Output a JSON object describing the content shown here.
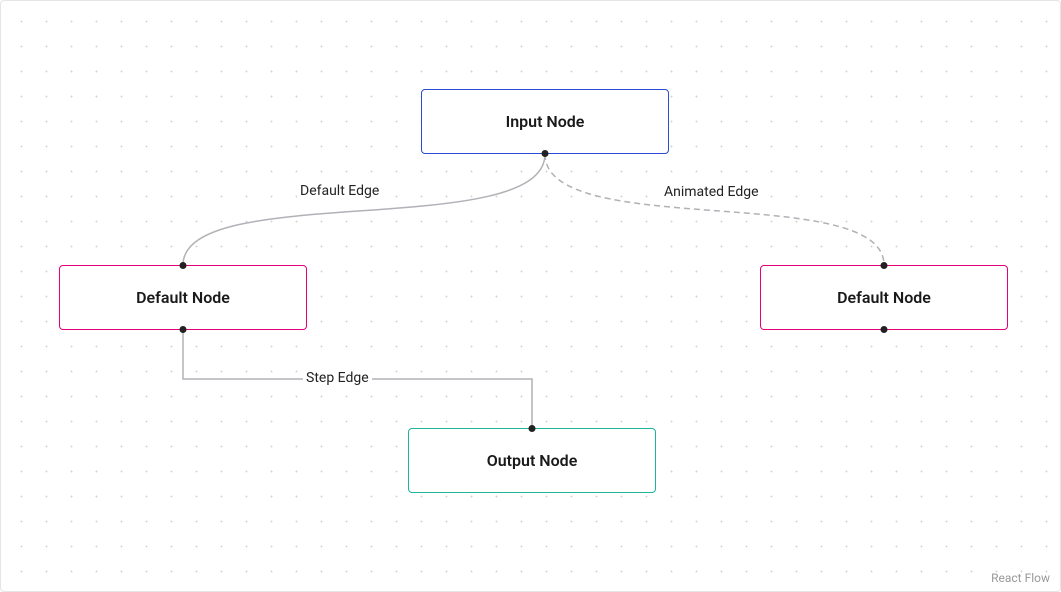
{
  "nodes": {
    "input": {
      "label": "Input Node"
    },
    "default_left": {
      "label": "Default Node"
    },
    "default_right": {
      "label": "Default Node"
    },
    "output": {
      "label": "Output Node"
    }
  },
  "edges": {
    "default_edge": {
      "label": "Default Edge"
    },
    "animated_edge": {
      "label": "Animated Edge"
    },
    "step_edge": {
      "label": "Step Edge"
    }
  },
  "attribution": "React Flow"
}
